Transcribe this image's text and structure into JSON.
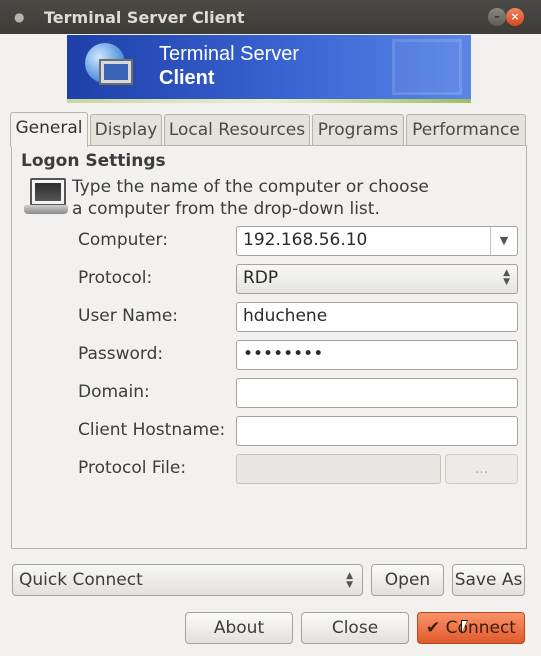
{
  "window": {
    "title": "Terminal Server Client"
  },
  "banner": {
    "line1": "Terminal Server",
    "line2": "Client"
  },
  "tabs": [
    {
      "label": "General",
      "active": true
    },
    {
      "label": "Display",
      "active": false
    },
    {
      "label": "Local Resources",
      "active": false
    },
    {
      "label": "Programs",
      "active": false
    },
    {
      "label": "Performance",
      "active": false
    }
  ],
  "logon": {
    "heading": "Logon Settings",
    "instructions": "Type the name of the computer or choose a computer from the drop-down list.",
    "fields": {
      "computer_label": "Computer:",
      "computer_value": "192.168.56.10",
      "protocol_label": "Protocol:",
      "protocol_value": "RDP",
      "username_label": "User Name:",
      "username_value": "hduchene",
      "password_label": "Password:",
      "password_value": "••••••••",
      "domain_label": "Domain:",
      "domain_value": "",
      "client_hostname_label": "Client Hostname:",
      "client_hostname_value": "",
      "protocol_file_label": "Protocol File:",
      "protocol_file_value": "",
      "protocol_file_browse": "..."
    }
  },
  "quick_connect": {
    "selected": "Quick Connect",
    "open": "Open",
    "save_as": "Save As"
  },
  "footer": {
    "about": "About",
    "close": "Close",
    "connect": "Connect",
    "connect_icon": "✔"
  },
  "colors": {
    "accent": "#e0592b",
    "titlebar": "#3c3b37"
  }
}
